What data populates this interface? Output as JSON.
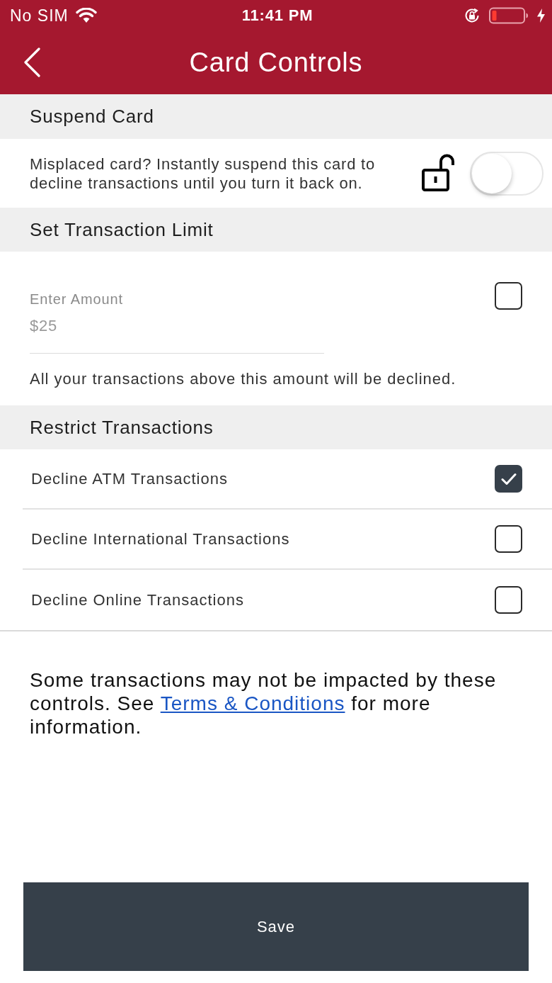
{
  "status_bar": {
    "carrier": "No SIM",
    "time": "11:41 PM"
  },
  "nav_bar": {
    "title": "Card Controls"
  },
  "suspend_card": {
    "heading": "Suspend Card",
    "description": "Misplaced card? Instantly suspend this card to decline transactions until you turn it back on.",
    "on": false
  },
  "transaction_limit": {
    "heading": "Set Transaction Limit",
    "amount_field": {
      "label": "Enter Amount",
      "placeholder": "$25"
    },
    "checked": false,
    "note": "All your transactions above this amount will be declined."
  },
  "restrict_transactions": {
    "heading": "Restrict Transactions",
    "options": [
      {
        "label": "Decline ATM Transactions",
        "checked": true
      },
      {
        "label": "Decline International Transactions",
        "checked": false
      },
      {
        "label": "Decline Online Transactions",
        "checked": false
      }
    ]
  },
  "disclaimer": {
    "before": "Some transactions may not be impacted by these controls. See",
    "link": "Terms & Conditions",
    "after": "for more information."
  },
  "save_button": {
    "label": "Save"
  }
}
